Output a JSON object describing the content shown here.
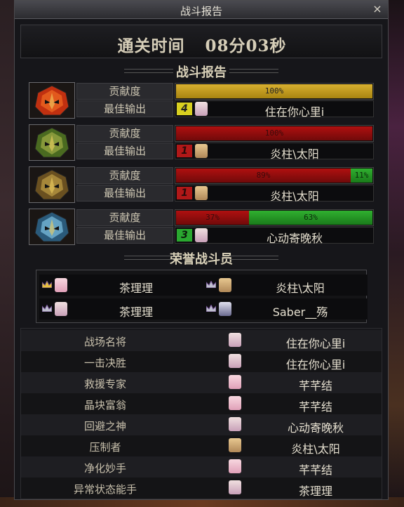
{
  "window": {
    "title": "战斗报告",
    "close_label": "×"
  },
  "clear_time": {
    "label": "通关时间",
    "value": "08分03秒"
  },
  "report_header": "战斗报告",
  "stat_labels": {
    "contribution": "贡献度",
    "best_damage": "最佳输出"
  },
  "dungeons": [
    {
      "icon": "fire-mask-icon",
      "colors": [
        "#c03010",
        "#e86020"
      ],
      "segments": [
        {
          "color": "gold",
          "value": 100,
          "label": "100%"
        }
      ],
      "rank": "4",
      "rank_color": "yellow",
      "avatar": "white",
      "best_player": "住在你心里i"
    },
    {
      "icon": "green-mask-icon",
      "colors": [
        "#4a6a20",
        "#90a040"
      ],
      "segments": [
        {
          "color": "red",
          "value": 100,
          "label": "100%"
        }
      ],
      "rank": "1",
      "rank_color": "red",
      "avatar": "blonde",
      "best_player": "炎柱\\太阳"
    },
    {
      "icon": "bronze-mask-icon",
      "colors": [
        "#6a5020",
        "#b09040"
      ],
      "segments": [
        {
          "color": "red",
          "value": 89,
          "label": "89%"
        },
        {
          "color": "green",
          "value": 11,
          "label": "11%"
        }
      ],
      "rank": "1",
      "rank_color": "red",
      "avatar": "blonde",
      "best_player": "炎柱\\太阳"
    },
    {
      "icon": "blue-mask-icon",
      "colors": [
        "#2a5a7a",
        "#70b0d0"
      ],
      "segments": [
        {
          "color": "red",
          "value": 37,
          "label": "37%"
        },
        {
          "color": "green",
          "value": 63,
          "label": "63%"
        }
      ],
      "rank": "3",
      "rank_color": "green",
      "avatar": "white",
      "best_player": "心动寄晚秋"
    }
  ],
  "honor_header": "荣誉战斗员",
  "honor_players": [
    {
      "name": "茶理理",
      "avatar": "pink",
      "crown": "gold-crown-icon"
    },
    {
      "name": "炎柱\\太阳",
      "avatar": "blonde",
      "crown": "silver-crown-icon"
    },
    {
      "name": "茶理理",
      "avatar": "white",
      "crown": "silver-crown-icon"
    },
    {
      "name": "Saber__殇",
      "avatar": "dark",
      "crown": "silver-crown-icon"
    }
  ],
  "awards": [
    {
      "title": "战场名将",
      "player": "住在你心里i",
      "avatar": "white"
    },
    {
      "title": "一击决胜",
      "player": "住在你心里i",
      "avatar": "white"
    },
    {
      "title": "救援专家",
      "player": "芊芊结",
      "avatar": "pink"
    },
    {
      "title": "晶块富翁",
      "player": "芊芊结",
      "avatar": "pink"
    },
    {
      "title": "回避之神",
      "player": "心动寄晚秋",
      "avatar": "white"
    },
    {
      "title": "压制者",
      "player": "炎柱\\太阳",
      "avatar": "blonde"
    },
    {
      "title": "净化妙手",
      "player": "芊芊结",
      "avatar": "pink"
    },
    {
      "title": "异常状态能手",
      "player": "茶理理",
      "avatar": "white"
    }
  ]
}
